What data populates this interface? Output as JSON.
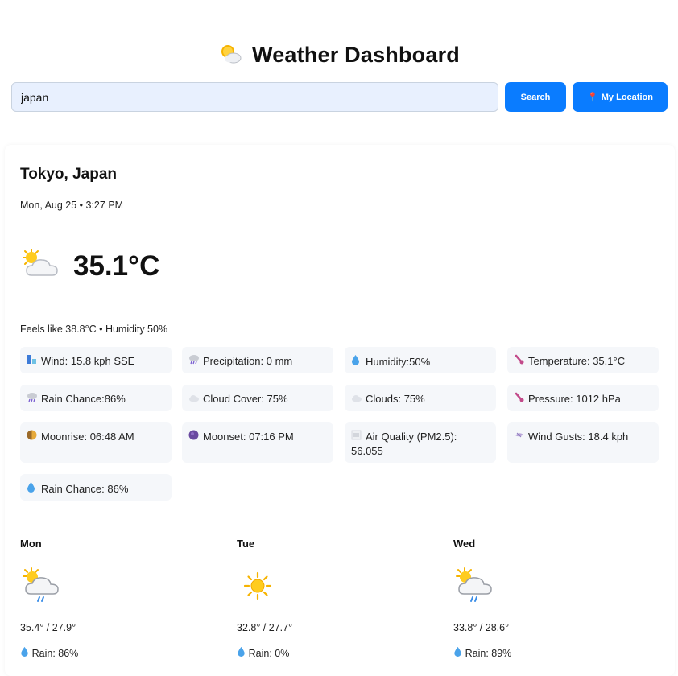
{
  "header": {
    "title": "Weather Dashboard",
    "icon": "sun-behind-cloud-icon"
  },
  "search": {
    "value": "japan",
    "search_label": "Search",
    "location_label": "My Location"
  },
  "current": {
    "location": "Tokyo, Japan",
    "datetime": "Mon, Aug 25 • 3:27 PM",
    "temperature": "35.1°C",
    "feels_line": "Feels like 38.8°C • Humidity 50%",
    "icon": "partly-sunny-icon"
  },
  "details": [
    {
      "icon": "wind-icon",
      "text": "Wind: 15.8 kph SSE"
    },
    {
      "icon": "rain-cloud-icon",
      "text": "Precipitation: 0 mm"
    },
    {
      "icon": "droplet-icon",
      "text": "Humidity:50%"
    },
    {
      "icon": "thermometer-icon",
      "text": "Temperature: 35.1°C"
    },
    {
      "icon": "rain-cloud-icon",
      "text": "Rain Chance:86%"
    },
    {
      "icon": "cloud-icon",
      "text": "Cloud Cover: 75%"
    },
    {
      "icon": "cloud-icon",
      "text": "Clouds: 75%"
    },
    {
      "icon": "thermometer-icon",
      "text": "Pressure: 1012 hPa"
    },
    {
      "icon": "moonrise-icon",
      "text": "Moonrise: 06:48 AM"
    },
    {
      "icon": "moonset-icon",
      "text": "Moonset: 07:16 PM"
    },
    {
      "icon": "fog-icon",
      "text": "Air Quality (PM2.5): 56.055"
    },
    {
      "icon": "wind-gust-icon",
      "text": "Wind Gusts: 18.4 kph"
    },
    {
      "icon": "droplet-icon",
      "text": "Rain Chance: 86%"
    }
  ],
  "forecast": [
    {
      "day": "Mon",
      "icon": "sun-cloud-rain-icon",
      "temps": "35.4° / 27.9°",
      "rain": "Rain: 86%"
    },
    {
      "day": "Tue",
      "icon": "sun-icon",
      "temps": "32.8° / 27.7°",
      "rain": "Rain: 0%"
    },
    {
      "day": "Wed",
      "icon": "sun-cloud-rain-icon",
      "temps": "33.8° / 28.6°",
      "rain": "Rain: 89%"
    }
  ]
}
